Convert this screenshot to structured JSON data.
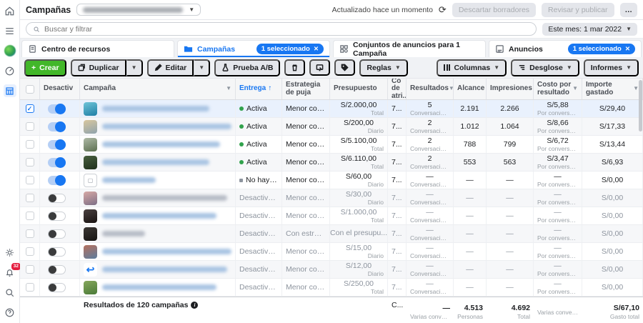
{
  "colors": {
    "accent": "#1877f2",
    "create_green": "#42b72a",
    "active_dot": "#31a24c"
  },
  "rail": {
    "notification_count": "32"
  },
  "topbar": {
    "title": "Campañas",
    "updated": "Actualizado hace un momento",
    "discard_label": "Descartar borradores",
    "publish_label": "Revisar y publicar",
    "more_label": "…"
  },
  "searchrow": {
    "placeholder": "Buscar y filtrar",
    "date_range": "Este mes: 1 mar 2022"
  },
  "tabs": {
    "resources": {
      "label": "Centro de recursos"
    },
    "campaigns": {
      "label": "Campañas",
      "badge": "1 seleccionado",
      "badge_close": "✕"
    },
    "adsets": {
      "label": "Conjuntos de anuncios para 1 Campaña"
    },
    "ads": {
      "label": "Anuncios",
      "badge": "1 seleccionado",
      "badge_close": "✕"
    }
  },
  "toolbar": {
    "create": "Crear",
    "duplicate": "Duplicar",
    "edit": "Editar",
    "ab_test": "Prueba A/B",
    "rules": "Reglas",
    "columns": "Columnas",
    "breakdown": "Desglose",
    "reports": "Informes"
  },
  "table": {
    "headers": {
      "toggle": "Desactiv",
      "campaign": "Campaña",
      "delivery": "Entrega",
      "delivery_sort": "↑",
      "bid": "Estrategia de puja",
      "budget": "Presupuesto",
      "attribution": "Co de atri...",
      "results": "Resultados",
      "reach": "Alcance",
      "impressions": "Impresiones",
      "cpr": "Costo por resultado",
      "spent": "Importe gastado"
    },
    "rows": [
      {
        "checked": true,
        "selected": true,
        "toggle": "on",
        "thumb_colors": [
          "#6fc5d8",
          "#1f7fa6"
        ],
        "name_width": 150,
        "name_color": "#a9c4e3",
        "status": "Activa",
        "status_dot": "green",
        "bid": "Menor costo",
        "budget": "S/2.000,00",
        "budget_sub": "Total",
        "attr": "7...",
        "results": "5",
        "results_sub": "Conversaciones c...",
        "reach": "2.191",
        "impr": "2.266",
        "cpr": "S/5,88",
        "cpr_sub": "Por conversaci...",
        "spent": "S/29,40"
      },
      {
        "toggle": "on",
        "thumb_colors": [
          "#d9c79e",
          "#8fa3ad"
        ],
        "name_width": 185,
        "name_color": "#a9c4e3",
        "status": "Activa",
        "status_dot": "green",
        "bid": "Menor costo",
        "budget": "S/200,00",
        "budget_sub": "Diario",
        "attr": "7...",
        "results": "2",
        "results_sub": "Conversaciones c...",
        "reach": "1.012",
        "impr": "1.064",
        "cpr": "S/8,66",
        "cpr_sub": "Por conversaci...",
        "spent": "S/17,33"
      },
      {
        "toggle": "on",
        "thumb_colors": [
          "#aeb9a6",
          "#5c7050"
        ],
        "name_width": 165,
        "name_color": "#a9c4e3",
        "status": "Activa",
        "status_dot": "green",
        "bid": "Menor costo",
        "budget": "S/5.100,00",
        "budget_sub": "Total",
        "attr": "7...",
        "results": "2",
        "results_sub": "Conversaciones c...",
        "reach": "788",
        "impr": "799",
        "cpr": "S/6,72",
        "cpr_sub": "Por conversaci...",
        "spent": "S/13,44"
      },
      {
        "toggle": "on",
        "thumb_colors": [
          "#49603f",
          "#20301c"
        ],
        "name_width": 150,
        "name_color": "#a9c4e3",
        "status": "Activa",
        "status_dot": "green",
        "bid": "Menor costo",
        "budget": "S/6.110,00",
        "budget_sub": "Total",
        "attr": "7...",
        "results": "2",
        "results_sub": "Conversaciones c...",
        "reach": "553",
        "impr": "563",
        "cpr": "S/3,47",
        "cpr_sub": "Por conversaci...",
        "spent": "S/6,93"
      },
      {
        "toggle": "on",
        "thumb": "empty",
        "name_width": 75,
        "name_color": "#a9c4e3",
        "status": "No hay anuncios",
        "status_dot": "gray",
        "bid": "Menor costo",
        "budget": "S/60,00",
        "budget_sub": "Diario",
        "attr": "7...",
        "results": "—",
        "results_sub": "Conversación con ...",
        "reach": "—",
        "impr": "—",
        "cpr": "—",
        "cpr_sub": "Por conversaci...",
        "spent": "S/0,00"
      },
      {
        "toggle": "off",
        "thumb_colors": [
          "#d8a9a5",
          "#7d6f86"
        ],
        "name_width": 175,
        "name_color": "#b7bcc6",
        "status": "Desactivado",
        "bid": "Menor costo",
        "budget": "S/30,00",
        "budget_sub": "Diario",
        "attr": "7...",
        "results": "—",
        "results_sub": "Conversación con ...",
        "reach": "—",
        "impr": "—",
        "cpr": "—",
        "cpr_sub": "Por conversaci...",
        "spent": "S/0,00"
      },
      {
        "toggle": "off",
        "thumb_colors": [
          "#4a4140",
          "#191312"
        ],
        "name_width": 160,
        "name_color": "#a9c4e3",
        "status": "Desactivado",
        "bid": "Menor costo",
        "budget": "S/1.000,00",
        "budget_sub": "Total",
        "attr": "7...",
        "results": "—",
        "results_sub": "Conversación con ...",
        "reach": "—",
        "impr": "—",
        "cpr": "—",
        "cpr_sub": "Por conversaci...",
        "spent": "S/0,00"
      },
      {
        "toggle": "off",
        "thumb_colors": [
          "#3b3734",
          "#161413"
        ],
        "name_width": 60,
        "name_color": "#b7bcc6",
        "status": "Desactivado",
        "bid": "Con estrategia ...",
        "budget": "Con el presupu...",
        "budget_sub": "",
        "attr": "7...",
        "results": "—",
        "results_sub": "Conversación con ...",
        "reach": "—",
        "impr": "—",
        "cpr": "—",
        "cpr_sub": "Por conversaci...",
        "spent": "S/0,00"
      },
      {
        "toggle": "off",
        "thumb_colors": [
          "#b5705e",
          "#5d7d9e"
        ],
        "name_width": 185,
        "name_color": "#a9c4e3",
        "status": "Desactivado",
        "bid": "Menor costo",
        "budget": "S/15,00",
        "budget_sub": "Diario",
        "attr": "7...",
        "results": "—",
        "results_sub": "Conversación con ...",
        "reach": "—",
        "impr": "—",
        "cpr": "—",
        "cpr_sub": "Por conversaci...",
        "spent": "S/0,00"
      },
      {
        "toggle": "off",
        "thumb": "arrow",
        "name_width": 175,
        "name_color": "#a9c4e3",
        "status": "Desactivado",
        "bid": "Menor costo",
        "budget": "S/12,00",
        "budget_sub": "Diario",
        "attr": "7...",
        "results": "—",
        "results_sub": "Conversación con ...",
        "reach": "—",
        "impr": "—",
        "cpr": "—",
        "cpr_sub": "Por conversaci...",
        "spent": "S/0,00"
      },
      {
        "toggle": "off",
        "thumb_colors": [
          "#86a75c",
          "#4a7a38"
        ],
        "name_width": 160,
        "name_color": "#a9c4e3",
        "status": "Desactivado",
        "bid": "Menor costo",
        "budget": "S/250,00",
        "budget_sub": "Total",
        "attr": "7...",
        "results": "—",
        "results_sub": "Conversación con ...",
        "reach": "—",
        "impr": "—",
        "cpr": "—",
        "cpr_sub": "Por conversaci...",
        "spent": "S/0,00"
      }
    ],
    "footer": {
      "label": "Resultados de 120 campañas",
      "attr": "C...",
      "results": "—",
      "results_sub": "Varias conversiones",
      "reach": "4.513",
      "reach_sub": "Personas",
      "impr": "4.692",
      "impr_sub": "Total",
      "cpr_sub": "Varias conversion...",
      "spent": "S/67,10",
      "spent_sub": "Gasto total"
    }
  }
}
